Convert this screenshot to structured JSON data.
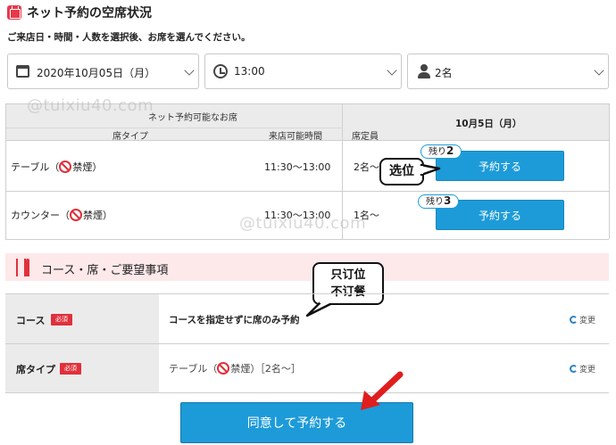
{
  "header": {
    "title": "ネット予約の空席状況",
    "instruction": "ご来店日・時間・人数を選択後、お席を選んでください。"
  },
  "selectors": {
    "date": "2020年10月05日（月）",
    "time": "13:00",
    "people": "2名"
  },
  "table": {
    "group_header": "ネット予約可能なお席",
    "columns": [
      "席タイプ",
      "来店可能時間",
      "席定員"
    ],
    "date_header": "10月5日（月）",
    "rows": [
      {
        "type": "テーブル（",
        "smoking": "禁煙）",
        "time": "11:30～13:00",
        "capacity": "2名～",
        "remain_label": "残り",
        "remain_count": "2",
        "button": "予約する"
      },
      {
        "type": "カウンター（",
        "smoking": "禁煙）",
        "time": "11:30～13:00",
        "capacity": "1名～",
        "remain_label": "残り",
        "remain_count": "3",
        "button": "予約する"
      }
    ]
  },
  "annotations": {
    "seat_pick": "选位",
    "seat_only_line1": "只订位",
    "seat_only_line2": "不订餐"
  },
  "section": {
    "title": "コース・席・ご要望事項"
  },
  "form": {
    "course": {
      "label": "コース",
      "required": "必須",
      "value": "コースを指定せずに席のみ予約",
      "change": "変更"
    },
    "seat_type": {
      "label": "席タイプ",
      "required": "必須",
      "value_prefix": "テーブル（",
      "value_suffix": "禁煙）［2名～］",
      "change": "変更"
    }
  },
  "agree_button": "同意して予約する",
  "watermark": "@tuixiu40.com",
  "colors": {
    "accent_blue": "#1d9bd8",
    "accent_red": "#e0303b",
    "section_pink": "#fde8ea"
  }
}
